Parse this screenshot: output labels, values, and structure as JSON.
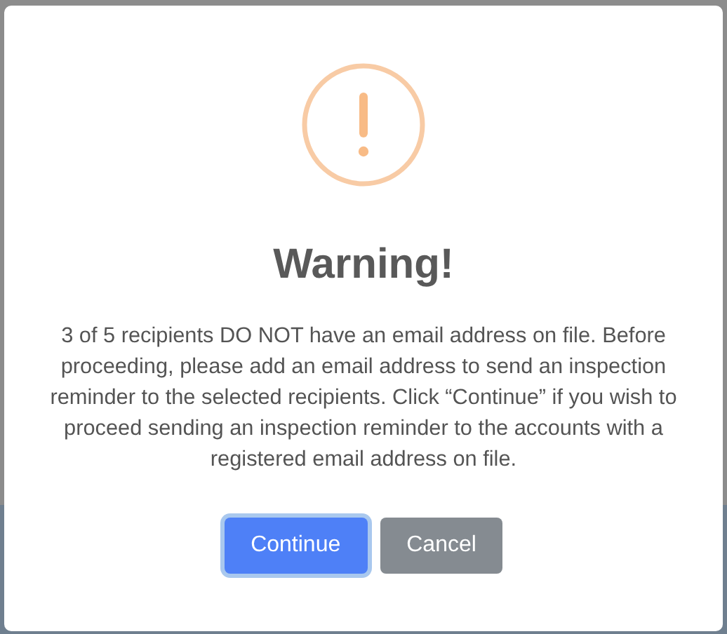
{
  "dialog": {
    "title": "Warning!",
    "message": "3 of 5 recipients DO NOT have an email address on file. Before proceeding, please add an email address to send an inspection reminder to the selected recipients. Click “Continue” if you wish to proceed sending an inspection reminder to the accounts with a registered email address on file.",
    "buttons": [
      {
        "label": "Continue",
        "kind": "primary",
        "focused": true
      },
      {
        "label": "Cancel",
        "kind": "secondary",
        "focused": false
      }
    ]
  }
}
